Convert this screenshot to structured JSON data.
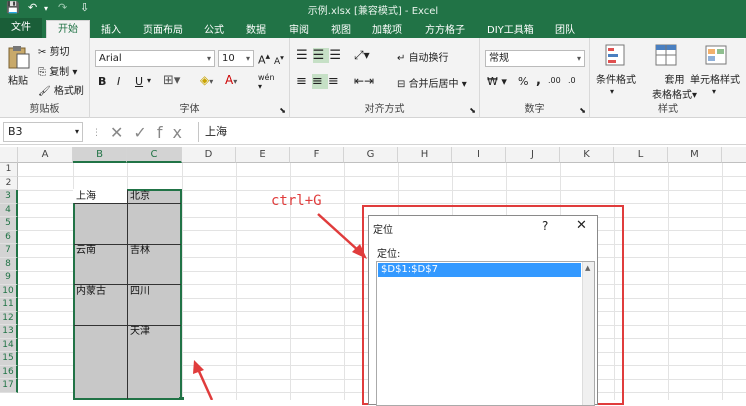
{
  "window": {
    "title": "示例.xlsx [兼容模式] - Excel",
    "qa_save": "💾",
    "qa_undo": "↶",
    "qa_redo": "↷",
    "qa_more": "⇩"
  },
  "tabs": [
    "文件",
    "开始",
    "插入",
    "页面布局",
    "公式",
    "数据",
    "审阅",
    "视图",
    "加载项",
    "方方格子",
    "DIY工具箱",
    "团队"
  ],
  "ribbon": {
    "clipboard": {
      "label": "剪贴板",
      "paste": "粘贴",
      "cut": "剪切",
      "copy": "复制",
      "painter": "格式刷"
    },
    "font": {
      "label": "字体",
      "name": "Arial",
      "size": "10",
      "bold": "B",
      "italic": "I",
      "underline": "U",
      "grow": "A",
      "shrink": "A",
      "wen": "wén"
    },
    "alignment": {
      "label": "对齐方式",
      "wrap": "自动换行",
      "merge": "合并后居中"
    },
    "number": {
      "label": "数字",
      "format": "常规",
      "currency": "₩",
      "percent": "%",
      "comma": ",",
      "inc": ".00",
      "dec": ".0"
    },
    "styles": {
      "label": "样式",
      "cond": "条件格式",
      "table_l1": "套用",
      "table_l2": "表格格式",
      "cellstyle": "单元格样式"
    }
  },
  "formula_bar": {
    "name_box": "B3",
    "value": "上海",
    "icons": "✕✓fx"
  },
  "columns": [
    "A",
    "B",
    "C",
    "D",
    "E",
    "F",
    "G",
    "H",
    "I",
    "J",
    "K",
    "L",
    "M"
  ],
  "rows": [
    "1",
    "2",
    "3",
    "4",
    "5",
    "6",
    "7",
    "8",
    "9",
    "10",
    "11",
    "12",
    "13",
    "14",
    "15",
    "16",
    "17"
  ],
  "cells": {
    "b3": "上海",
    "c3": "北京",
    "b7": "云南",
    "c7": "吉林",
    "b10": "内蒙古",
    "c10": "四川",
    "c13": "天津"
  },
  "annotation": "ctrl+G",
  "dialog": {
    "title": "定位",
    "help": "?",
    "close": "✕",
    "label": "定位:",
    "item": "$D$1:$D$7"
  },
  "colors": {
    "excel_green": "#217346",
    "annotation_red": "#e03c3c",
    "selection": "#3399ff"
  }
}
